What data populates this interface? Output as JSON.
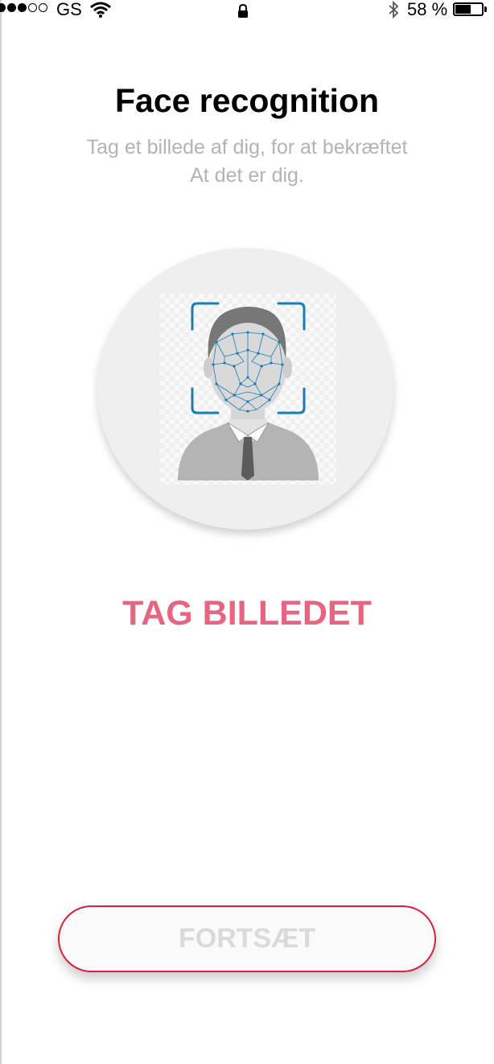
{
  "status_bar": {
    "carrier": "GS",
    "signal_bars_filled": 3,
    "signal_bars_total": 5,
    "battery_percent_label": "58 %",
    "battery_level": 0.58,
    "icons": [
      "wifi-icon",
      "lock-icon",
      "bluetooth-icon",
      "battery-icon"
    ]
  },
  "screen": {
    "title": "Face recognition",
    "subtitle_line1": "Tag et billede af dig, for at bekræftet",
    "subtitle_line2": "At det er dig.",
    "illustration": "face-scan-illustration",
    "take_photo_label": "TAG BILLEDET",
    "continue_label": "FORTSÆT"
  },
  "colors": {
    "accent_pink": "#e66580",
    "button_border_red": "#d2233f",
    "subtitle_gray": "#b3b3b3",
    "disabled_text": "#dadada",
    "face_scan_blue": "#1b7bb4"
  }
}
